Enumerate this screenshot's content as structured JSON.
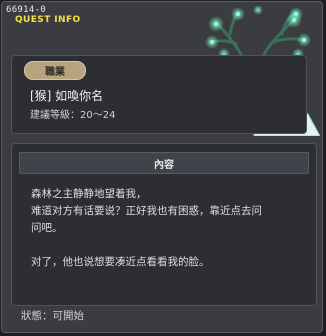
{
  "quest": {
    "id": "66914-0",
    "header_label": "QUEST INFO",
    "category_badge": "職業",
    "name": "[猴] 如喚你名",
    "level_requirement": "建議等級：20～24"
  },
  "content": {
    "title": "內容",
    "lines": [
      "森林之主静静地望着我，",
      "难道对方有话要说？正好我也有困惑，靠近点去问",
      "问吧。",
      "对了，他也说想要凑近点看看我的脸。"
    ]
  },
  "status": {
    "label": "狀態：",
    "value": "可開始"
  },
  "colors": {
    "header_label": "#f2e04a",
    "badge_bg": "#b8a37f",
    "window_bg": "#3a3c40",
    "panel_bg": "#2c2e31"
  },
  "icons": [
    "forest-lord-deer-icon"
  ]
}
